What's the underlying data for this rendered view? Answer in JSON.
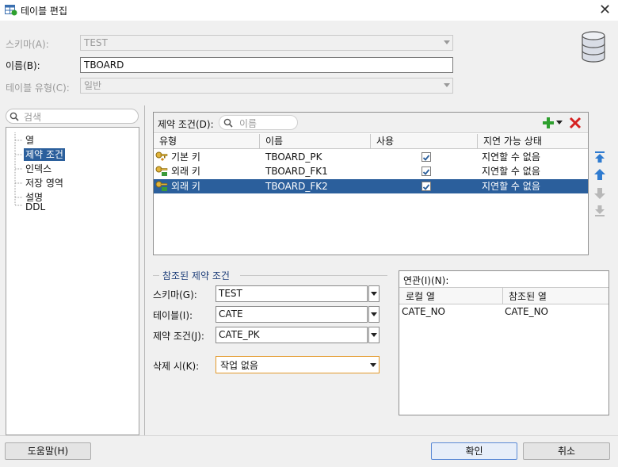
{
  "window": {
    "title": "테이블 편집",
    "close_label": "✕"
  },
  "form": {
    "schema_label": "스키마(A):",
    "schema_value": "TEST",
    "name_label": "이름(B):",
    "name_value": "TBOARD",
    "table_type_label": "테이블 유형(C):",
    "table_type_value": "일반"
  },
  "sidebar": {
    "search_placeholder": "검색",
    "items": [
      {
        "label": "열"
      },
      {
        "label": "제약 조건"
      },
      {
        "label": "인덱스"
      },
      {
        "label": "저장 영역"
      },
      {
        "label": "설명"
      },
      {
        "label": "DDL"
      }
    ]
  },
  "constraints": {
    "label": "제약 조건(D):",
    "filter_placeholder": "이름",
    "columns": [
      "유형",
      "이름",
      "사용",
      "지연 가능 상태"
    ],
    "rows": [
      {
        "type": "기본 키",
        "name": "TBOARD_PK",
        "enabled": true,
        "deferrable": "지연할 수 없음"
      },
      {
        "type": "외래 키",
        "name": "TBOARD_FK1",
        "enabled": true,
        "deferrable": "지연할 수 없음"
      },
      {
        "type": "외래 키",
        "name": "TBOARD_FK2",
        "enabled": true,
        "deferrable": "지연할 수 없음"
      }
    ]
  },
  "referenced": {
    "group_title": "참조된 제약 조건",
    "schema_label": "스키마(G):",
    "schema_value": "TEST",
    "table_label": "테이블(I):",
    "table_value": "CATE",
    "constraint_label": "제약 조건(J):",
    "constraint_value": "CATE_PK",
    "on_delete_label": "삭제 시(K):",
    "on_delete_value": "작업 없음"
  },
  "association": {
    "label": "연관(I)(N):",
    "columns": [
      "로컬 열",
      "참조된 열"
    ],
    "rows": [
      {
        "local": "CATE_NO",
        "referenced": "CATE_NO"
      }
    ]
  },
  "buttons": {
    "help": "도움말(H)",
    "ok": "확인",
    "cancel": "취소"
  },
  "colors": {
    "selection": "#2b5f9c",
    "add_green": "#2ea02e",
    "delete_red": "#d52020"
  }
}
